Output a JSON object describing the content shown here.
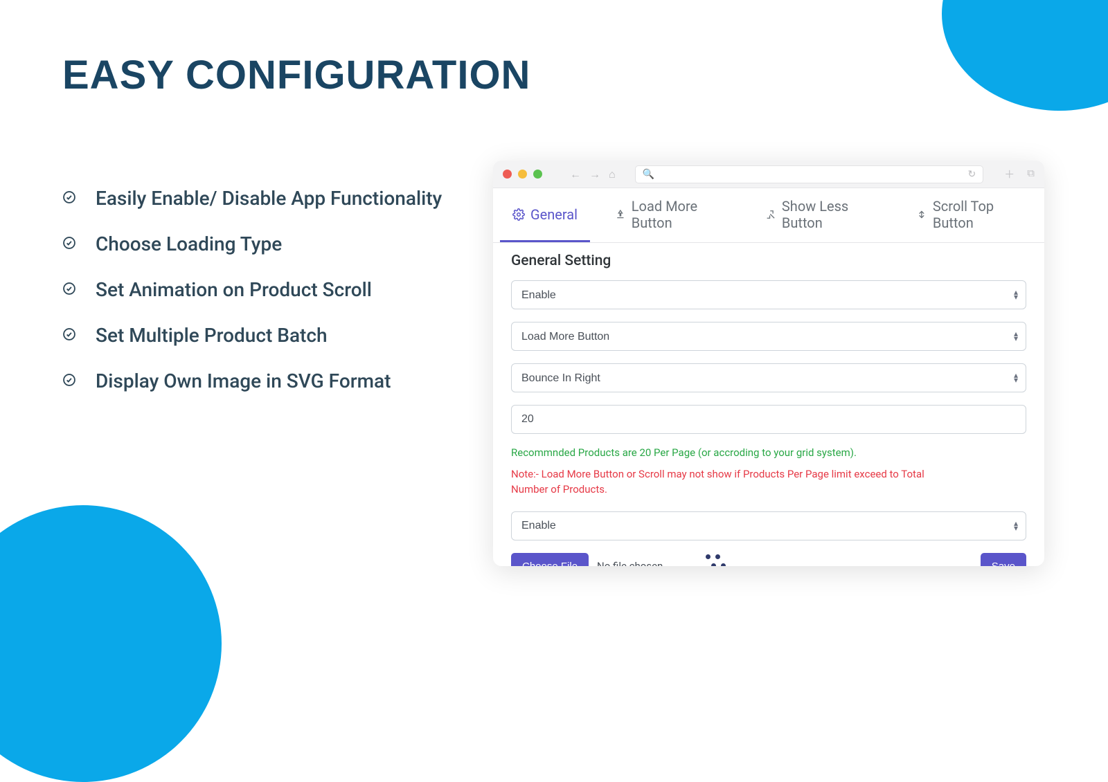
{
  "title": "EASY CONFIGURATION",
  "features": [
    "Easily Enable/ Disable App Functionality",
    "Choose Loading Type",
    "Set Animation on Product Scroll",
    "Set Multiple Product Batch",
    "Display Own Image in SVG Format"
  ],
  "tabs": {
    "general": "General",
    "load_more": "Load More Button",
    "show_less": "Show Less Button",
    "scroll_top": "Scroll Top Button"
  },
  "panel": {
    "title": "General Setting",
    "enable_select": "Enable",
    "loading_type_select": "Load More Button",
    "animation_select": "Bounce In Right",
    "batch_value": "20",
    "hint_green": "Recommnded Products are 20 Per Page (or accroding to your grid system).",
    "hint_red": "Note:- Load More Button or Scroll may not show if Products Per Page limit exceed to Total Number of Products.",
    "image_enable_select": "Enable",
    "choose_file_label": "Choose File",
    "no_file": "No file chosen",
    "save_label": "Save"
  }
}
